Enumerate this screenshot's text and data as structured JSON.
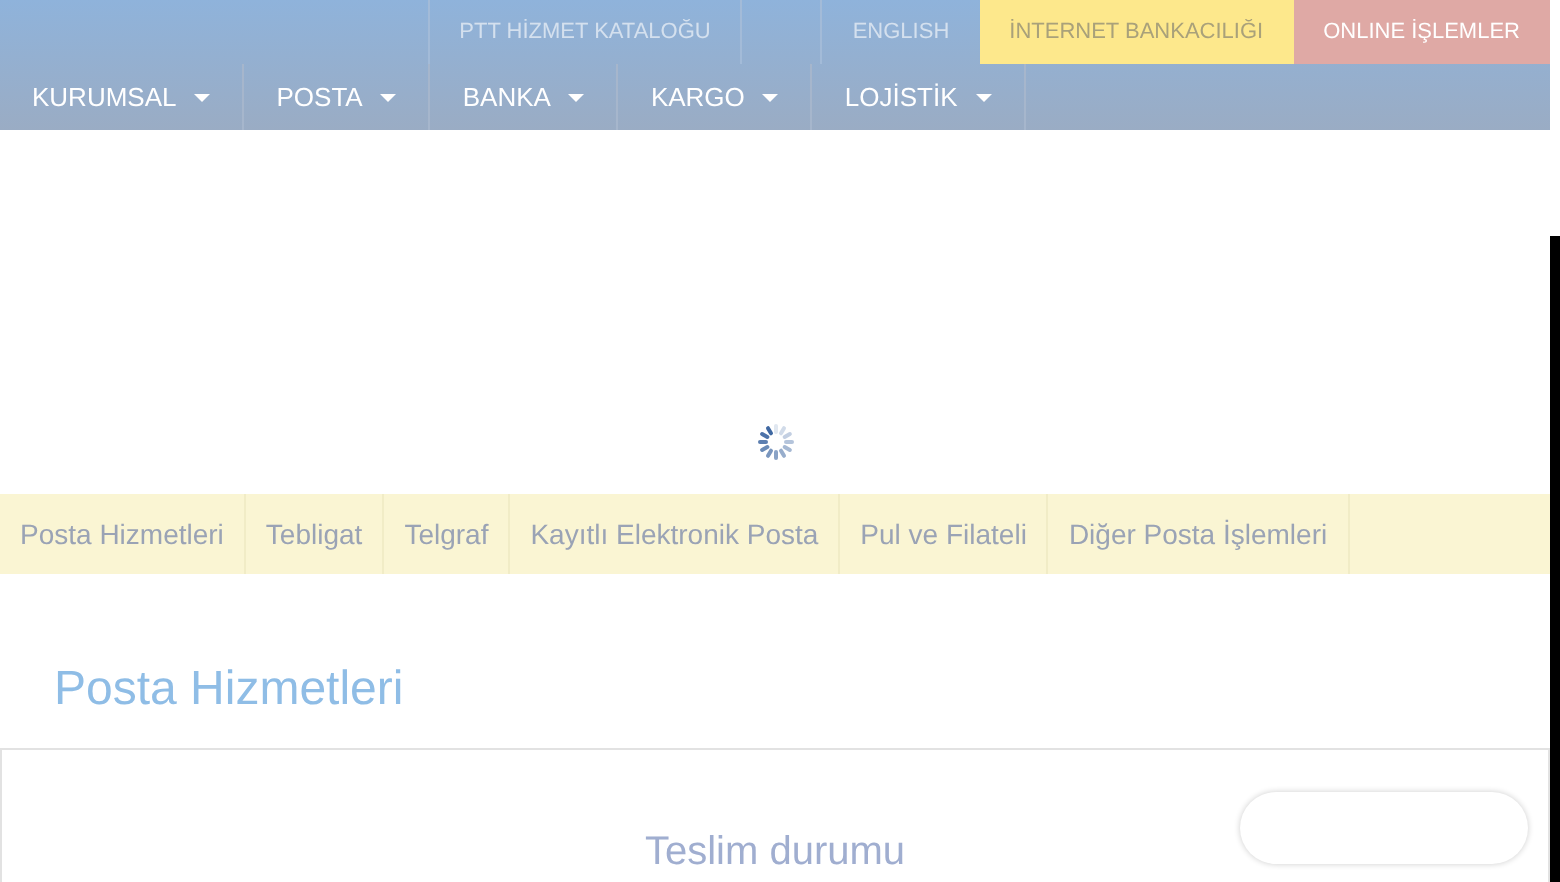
{
  "top_links": [
    {
      "label": "PTT HİZMET KATALOĞU",
      "kind": "plain"
    },
    {
      "label": "ENGLISH",
      "kind": "plain"
    },
    {
      "label": "İNTERNET BANKACILIĞI",
      "kind": "bank"
    },
    {
      "label": "ONLINE İŞLEMLER",
      "kind": "online"
    }
  ],
  "main_menu": [
    {
      "label": "KURUMSAL"
    },
    {
      "label": "POSTA"
    },
    {
      "label": "BANKA"
    },
    {
      "label": "KARGO"
    },
    {
      "label": "LOJİSTİK"
    }
  ],
  "sub_menu": [
    {
      "label": "Posta Hizmetleri"
    },
    {
      "label": "Tebligat"
    },
    {
      "label": "Telgraf"
    },
    {
      "label": "Kayıtlı Elektronik Posta"
    },
    {
      "label": "Pul ve Filateli"
    },
    {
      "label": "Diğer Posta İşlemleri"
    }
  ],
  "heading": "Posta Hizmetleri",
  "card": {
    "title": "Teslim durumu"
  }
}
